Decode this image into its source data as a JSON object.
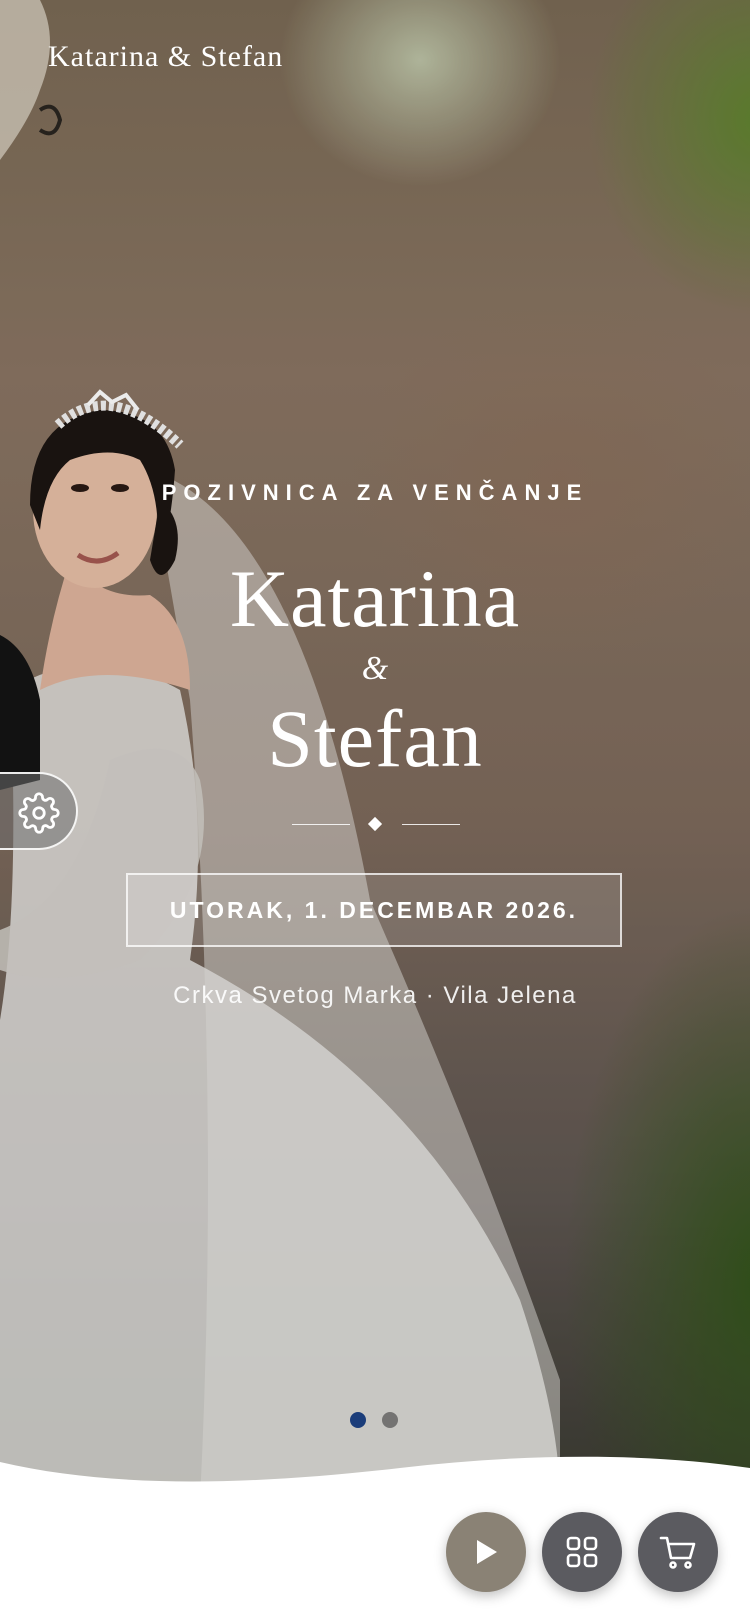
{
  "header": {
    "brand": "Katarina & Stefan"
  },
  "hero": {
    "eyebrow": "POZIVNICA ZA VENČANJE",
    "name_first": "Katarina",
    "ampersand": "&",
    "name_second": "Stefan",
    "date": "UTORAK, 1. DECEMBAR 2026.",
    "venue": "Crkva Svetog Marka · Vila Jelena"
  },
  "carousel": {
    "total_slides": 2,
    "active_slide": 1
  },
  "controls": {
    "settings_icon": "gear-icon",
    "play_icon": "play-icon",
    "menu_icon": "grid-icon",
    "cart_icon": "cart-icon"
  },
  "colors": {
    "active_dot": "#1b3d7a",
    "play_button": "#8a8275",
    "dark_button": "#5b5b60"
  }
}
